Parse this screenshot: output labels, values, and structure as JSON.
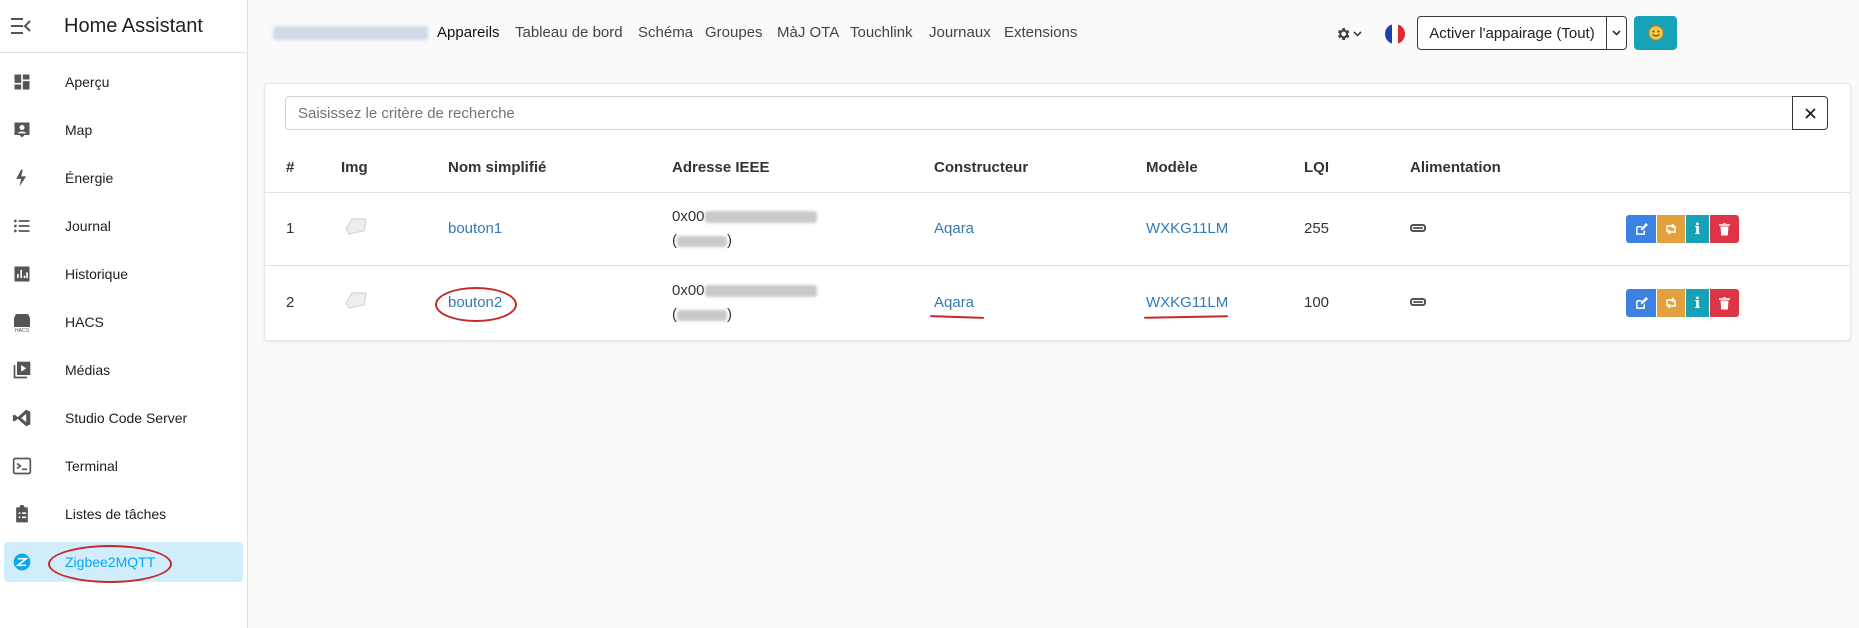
{
  "sidebar": {
    "title": "Home Assistant",
    "items": [
      {
        "label": "Aperçu",
        "icon": "dashboard-icon"
      },
      {
        "label": "Map",
        "icon": "map-account-icon"
      },
      {
        "label": "Énergie",
        "icon": "lightning-bolt-icon"
      },
      {
        "label": "Journal",
        "icon": "format-list-bulleted-icon"
      },
      {
        "label": "Historique",
        "icon": "chart-box-icon"
      },
      {
        "label": "HACS",
        "icon": "hacs-icon"
      },
      {
        "label": "Médias",
        "icon": "play-box-multiple-icon"
      },
      {
        "label": "Studio Code Server",
        "icon": "vscode-icon"
      },
      {
        "label": "Terminal",
        "icon": "console-icon"
      },
      {
        "label": "Listes de tâches",
        "icon": "clipboard-list-icon"
      },
      {
        "label": "Zigbee2MQTT",
        "icon": "zigbee-icon",
        "active": true
      }
    ]
  },
  "topnav": {
    "links": [
      "Appareils",
      "Tableau de bord",
      "Schéma",
      "Groupes",
      "MàJ OTA",
      "Touchlink",
      "Journaux",
      "Extensions"
    ],
    "active": "Appareils",
    "permit_join_label": "Activer l'appairage (Tout)"
  },
  "search": {
    "placeholder": "Saisissez le critère de recherche"
  },
  "table": {
    "columns": [
      "#",
      "Img",
      "Nom simplifié",
      "Adresse IEEE",
      "Constructeur",
      "Modèle",
      "LQI",
      "Alimentation"
    ],
    "rows": [
      {
        "index": "1",
        "name": "bouton1",
        "ieee_prefix": "0x00",
        "nwk_open": "(",
        "nwk_close": ")",
        "manufacturer": "Aqara",
        "model": "WXKG11LM",
        "lqi": "255",
        "power": "battery-icon"
      },
      {
        "index": "2",
        "name": "bouton2",
        "ieee_prefix": "0x00",
        "nwk_open": "(",
        "nwk_close": ")",
        "manufacturer": "Aqara",
        "model": "WXKG11LM",
        "lqi": "100",
        "power": "battery-icon"
      }
    ]
  },
  "colors": {
    "accent": "#03a9f4",
    "link": "#337ab7",
    "btn_edit": "#3c82e5",
    "btn_reconfigure": "#e3a13e",
    "btn_info": "#17a2b8",
    "btn_delete": "#dc3545",
    "annotation": "#c62828"
  }
}
